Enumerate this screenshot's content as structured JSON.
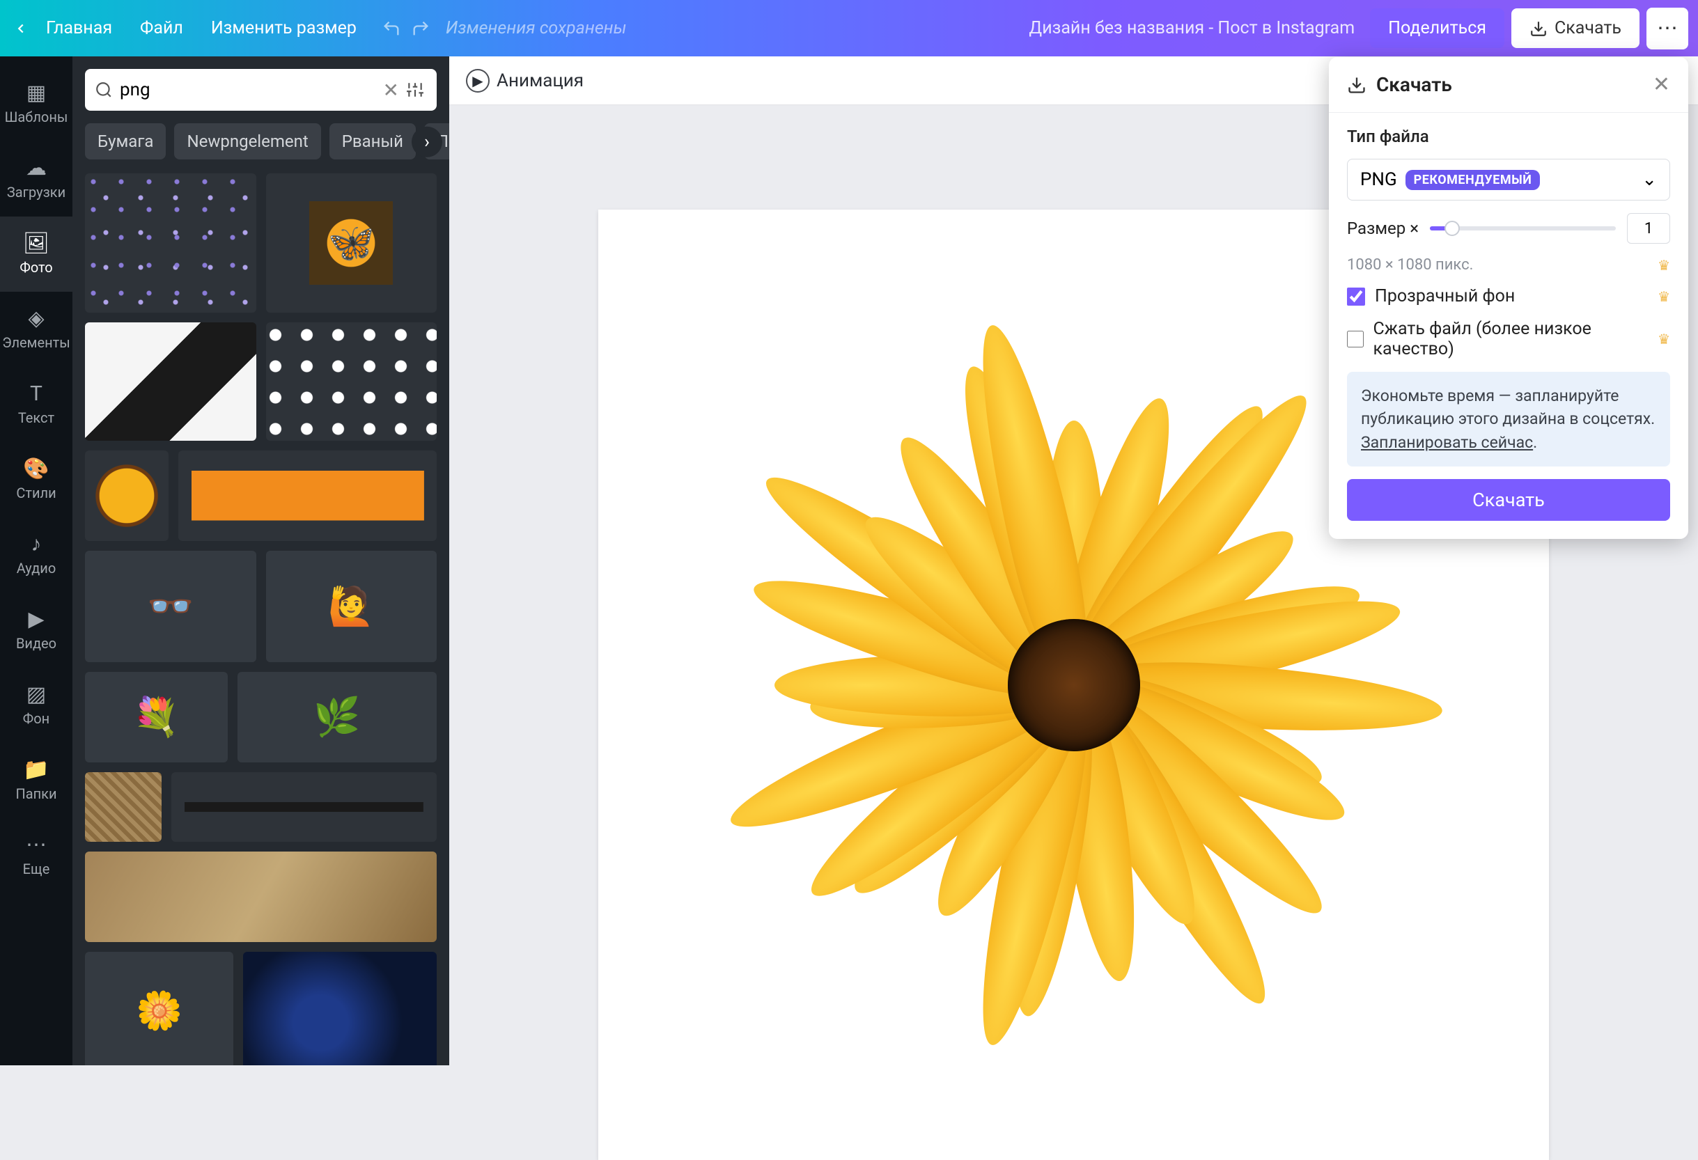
{
  "topbar": {
    "home": "Главная",
    "file": "Файл",
    "resize": "Изменить размер",
    "saved": "Изменения сохранены",
    "docname": "Дизайн без названия - Пост в Instagram",
    "share": "Поделиться",
    "download": "Скачать"
  },
  "nav": {
    "templates": "Шаблоны",
    "uploads": "Загрузки",
    "photos": "Фото",
    "elements": "Элементы",
    "text": "Текст",
    "styles": "Стили",
    "audio": "Аудио",
    "video": "Видео",
    "background": "Фон",
    "folders": "Папки",
    "more": "Еще"
  },
  "search": {
    "value": "png",
    "filter_icon": "sliders"
  },
  "chips": [
    "Бумага",
    "Newpngelement",
    "Рваный",
    "Ле"
  ],
  "toolbar2": {
    "animation": "Анимация"
  },
  "popover": {
    "title": "Скачать",
    "filetype_label": "Тип файла",
    "filetype_value": "PNG",
    "filetype_badge": "РЕКОМЕНДУЕМЫЙ",
    "size_label": "Размер ×",
    "size_value": "1",
    "dims": "1080 × 1080 пикс.",
    "transparent": "Прозрачный фон",
    "compress": "Сжать файл (более низкое качество)",
    "tip_text": "Экономьте время — запланируйте публикацию этого дизайна в соцсетях. ",
    "tip_link": "Запланировать сейчас",
    "download_btn": "Скачать"
  }
}
